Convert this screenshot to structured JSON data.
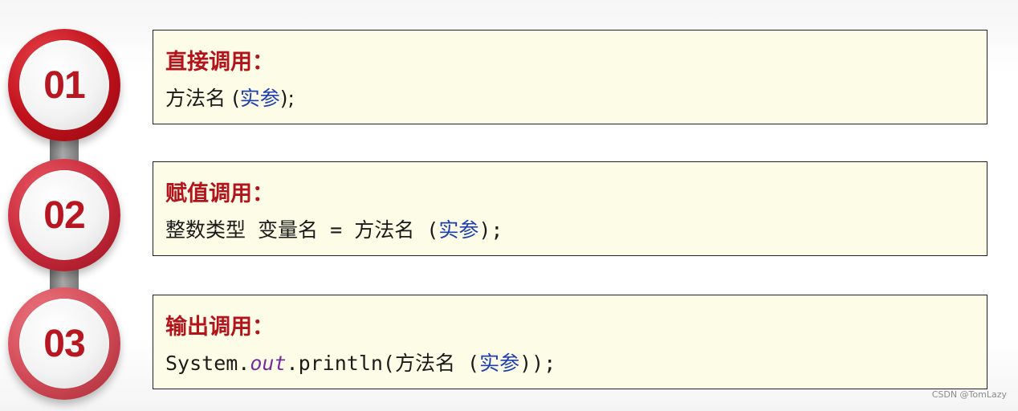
{
  "steps": [
    {
      "number": "01",
      "title": "直接调用：",
      "code_before": "方法名 (",
      "code_highlight": "实参",
      "code_after": ");",
      "ring_color": "#c0111b"
    },
    {
      "number": "02",
      "title": "赋值调用：",
      "code_before": "整数类型 变量名 = 方法名 (",
      "code_highlight": "实参",
      "code_after": ");",
      "ring_color": "#c7283a"
    },
    {
      "number": "03",
      "title": "输出调用：",
      "code_prefix": "System.",
      "code_field": "out",
      "code_before": ".println(方法名 (",
      "code_highlight": "实参",
      "code_after": "));",
      "ring_color": "#d24a57"
    }
  ],
  "watermark": "CSDN @TomLazy",
  "colors": {
    "title_red": "#b3141c",
    "card_bg": "#fdfde7",
    "highlight_blue": "#1f3fb0",
    "field_purple": "#7a2a9a"
  }
}
